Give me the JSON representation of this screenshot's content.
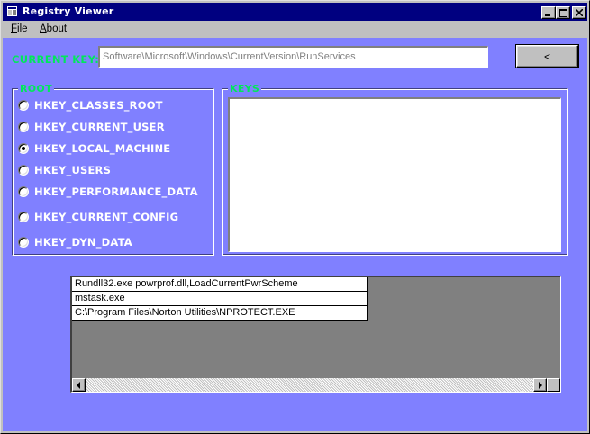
{
  "window": {
    "title": "Registry Viewer"
  },
  "menu": {
    "items": [
      {
        "label": "File",
        "hotkey": "F",
        "rest": "ile"
      },
      {
        "label": "About",
        "hotkey": "A",
        "rest": "bout"
      }
    ]
  },
  "current_key": {
    "label": "CURRENT KEY:",
    "value": "Software\\Microsoft\\Windows\\CurrentVersion\\RunServices"
  },
  "back_button": {
    "label": "<"
  },
  "root": {
    "legend": "ROOT",
    "options": [
      {
        "label": "HKEY_CLASSES_ROOT",
        "checked": false
      },
      {
        "label": "HKEY_CURRENT_USER",
        "checked": false
      },
      {
        "label": "HKEY_LOCAL_MACHINE",
        "checked": true
      },
      {
        "label": "HKEY_USERS",
        "checked": false
      },
      {
        "label": "HKEY_PERFORMANCE_DATA",
        "checked": false
      },
      {
        "label": "HKEY_CURRENT_CONFIG",
        "checked": false
      },
      {
        "label": "HKEY_DYN_DATA",
        "checked": false
      }
    ]
  },
  "keys": {
    "legend": "KEYS",
    "items": []
  },
  "values": {
    "rows": [
      "Rundll32.exe powrprof.dll,LoadCurrentPwrScheme",
      "mstask.exe",
      "C:\\Program Files\\Norton Utilities\\NPROTECT.EXE"
    ]
  },
  "colors": {
    "client_background": "#8080ff",
    "label_green": "#00e85a",
    "title_bar": "#000080"
  },
  "icons": {
    "app": "window-app-icon",
    "minimize": "minimize-icon",
    "maximize": "maximize-icon",
    "close": "close-icon",
    "scroll_left": "arrow-left-icon",
    "scroll_right": "arrow-right-icon"
  }
}
